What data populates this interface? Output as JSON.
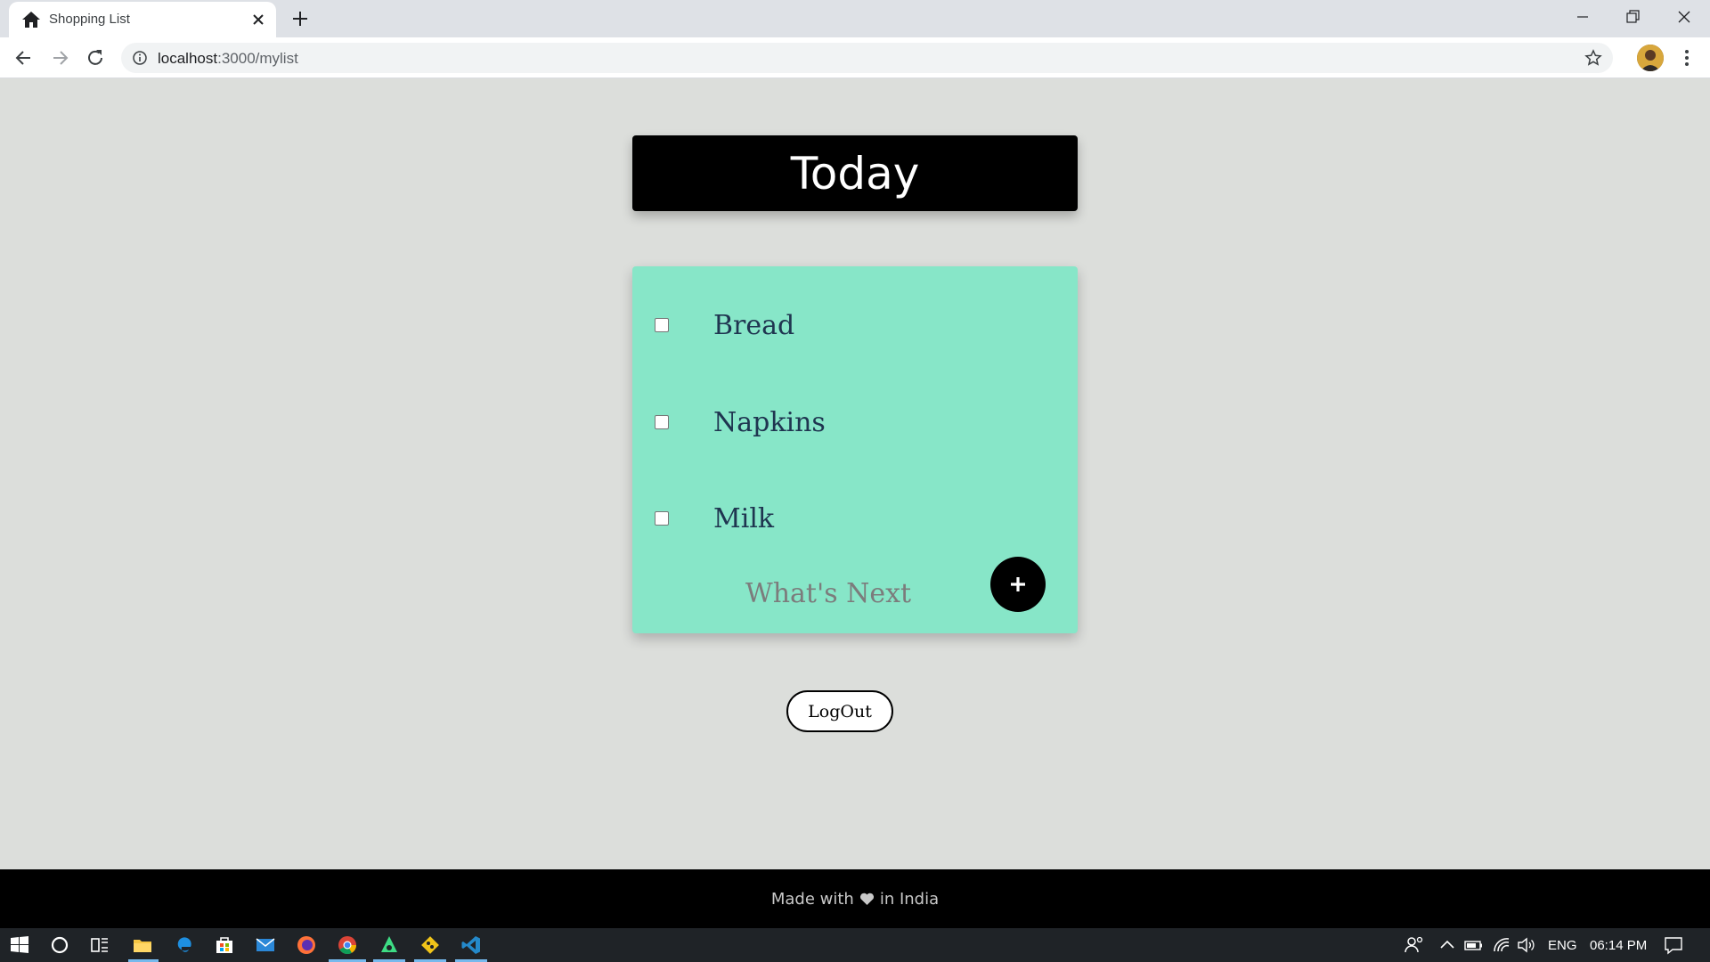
{
  "browser": {
    "tab_title": "Shopping List",
    "url_host": "localhost",
    "url_path": ":3000/mylist"
  },
  "app": {
    "heading": "Today",
    "items": [
      {
        "label": "Bread",
        "checked": false
      },
      {
        "label": "Napkins",
        "checked": false
      },
      {
        "label": "Milk",
        "checked": false
      }
    ],
    "new_item_placeholder": "What's Next",
    "add_button_label": "+",
    "logout_label": "LogOut"
  },
  "footer": {
    "made_with": "Made with",
    "in_country": "in India"
  },
  "taskbar": {
    "language": "ENG",
    "time": "06:14 PM"
  },
  "colors": {
    "page_bg": "#dcdedb",
    "list_bg": "#87e6c8",
    "heading_bg": "#000000",
    "footer_bg": "#000000",
    "taskbar_bg": "#1f2327"
  }
}
